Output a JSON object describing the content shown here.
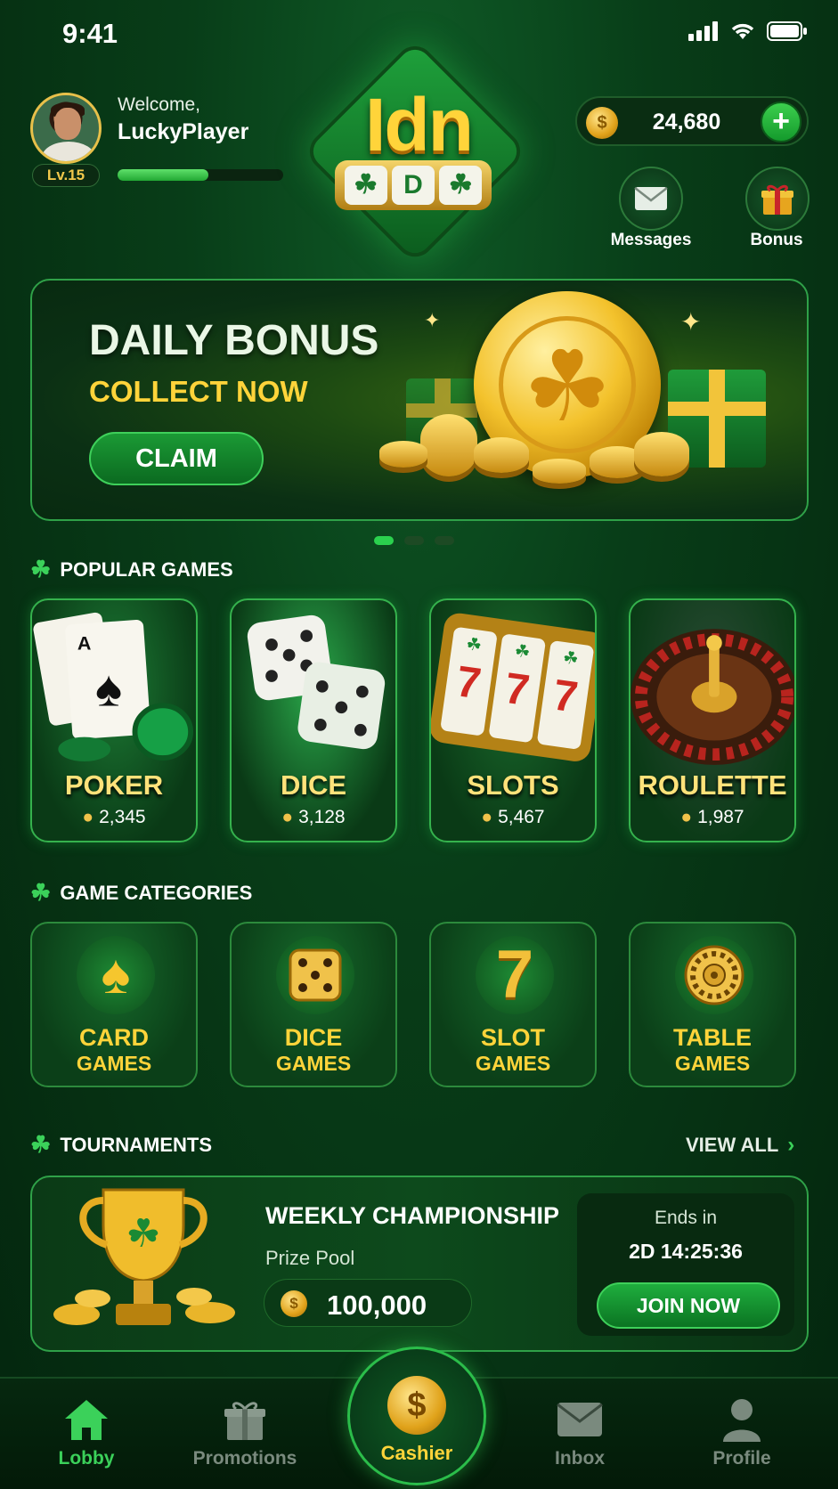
{
  "status": {
    "time": "9:41"
  },
  "profile": {
    "welcome": "Welcome,",
    "username": "LuckyPlayer",
    "level": "Lv.15",
    "xp_progress": 0.55
  },
  "logo": {
    "text": "Idn",
    "reel_left": "☘",
    "reel_center": "D",
    "reel_right": "☘"
  },
  "balance": {
    "value": "24,680",
    "add_label": "+",
    "coin_symbol": "$"
  },
  "actions": {
    "messages": "Messages",
    "bonus": "Bonus"
  },
  "banner": {
    "title": "DAILY BONUS",
    "subtitle": "COLLECT NOW",
    "cta": "CLAIM",
    "slides": 3,
    "active_slide": 0
  },
  "popular": {
    "title": "POPULAR GAMES",
    "games": [
      {
        "name": "POKER",
        "players": "2,345"
      },
      {
        "name": "DICE",
        "players": "3,128"
      },
      {
        "name": "SLOTS",
        "players": "5,467"
      },
      {
        "name": "ROULETTE",
        "players": "1,987"
      }
    ]
  },
  "categories": {
    "title": "GAME CATEGORIES",
    "items": [
      {
        "line1": "CARD",
        "line2": "GAMES",
        "icon": "spade-icon"
      },
      {
        "line1": "DICE",
        "line2": "GAMES",
        "icon": "dice-icon"
      },
      {
        "line1": "SLOT",
        "line2": "GAMES",
        "icon": "seven-icon"
      },
      {
        "line1": "TABLE",
        "line2": "GAMES",
        "icon": "roulette-wheel-icon"
      }
    ]
  },
  "tournaments": {
    "title": "TOURNAMENTS",
    "view_all": "VIEW ALL",
    "card": {
      "name": "WEEKLY CHAMPIONSHIP",
      "prize_label": "Prize Pool",
      "prize": "100,000",
      "ends_label": "Ends in",
      "countdown": "2D 14:25:36",
      "cta": "JOIN NOW"
    }
  },
  "nav": {
    "lobby": "Lobby",
    "promotions": "Promotions",
    "cashier": "Cashier",
    "inbox": "Inbox",
    "profile": "Profile"
  },
  "colors": {
    "accent": "#2bd14e",
    "gold": "#ffd43a",
    "background": "#083d18"
  }
}
